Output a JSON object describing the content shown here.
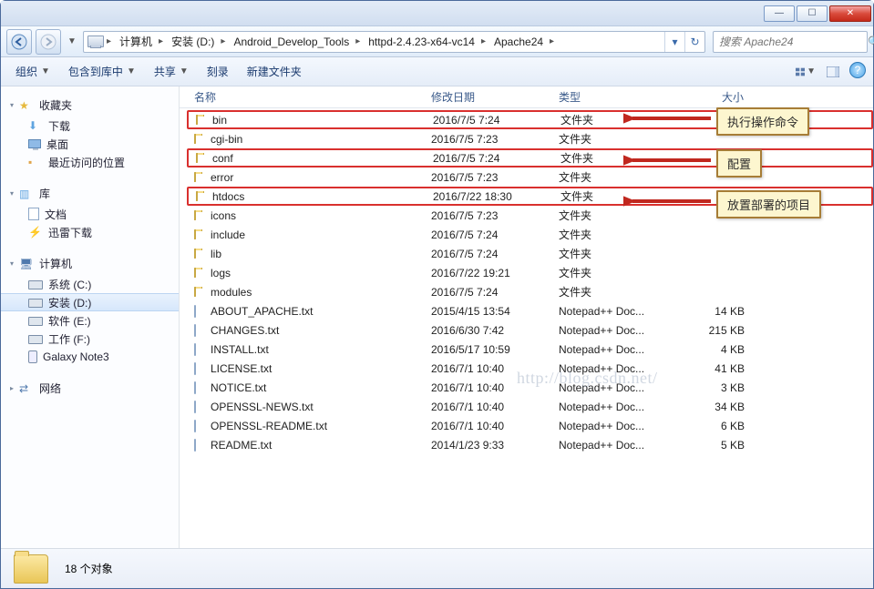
{
  "window": {
    "min_btn": "—",
    "max_btn": "☐",
    "close_btn": "✕"
  },
  "breadcrumb": {
    "items": [
      "计算机",
      "安装 (D:)",
      "Android_Develop_Tools",
      "httpd-2.4.23-x64-vc14",
      "Apache24"
    ]
  },
  "search": {
    "placeholder": "搜索 Apache24"
  },
  "toolbar": {
    "organize": "组织",
    "include": "包含到库中",
    "share": "共享",
    "burn": "刻录",
    "newfolder": "新建文件夹"
  },
  "columns": {
    "name": "名称",
    "date": "修改日期",
    "type": "类型",
    "size": "大小"
  },
  "sidebar": {
    "favorites": "收藏夹",
    "downloads": "下载",
    "desktop": "桌面",
    "recent": "最近访问的位置",
    "libraries": "库",
    "documents": "文档",
    "thunder": "迅雷下载",
    "computer": "计算机",
    "c_drive": "系统 (C:)",
    "d_drive": "安装 (D:)",
    "e_drive": "软件 (E:)",
    "f_drive": "工作 (F:)",
    "galaxy": "Galaxy Note3",
    "network": "网络"
  },
  "files": [
    {
      "name": "bin",
      "date": "2016/7/5 7:24",
      "type": "文件夹",
      "size": "",
      "kind": "folder",
      "hl": true
    },
    {
      "name": "cgi-bin",
      "date": "2016/7/5 7:23",
      "type": "文件夹",
      "size": "",
      "kind": "folder"
    },
    {
      "name": "conf",
      "date": "2016/7/5 7:24",
      "type": "文件夹",
      "size": "",
      "kind": "folder",
      "hl": true
    },
    {
      "name": "error",
      "date": "2016/7/5 7:23",
      "type": "文件夹",
      "size": "",
      "kind": "folder"
    },
    {
      "name": "htdocs",
      "date": "2016/7/22 18:30",
      "type": "文件夹",
      "size": "",
      "kind": "folder",
      "hl": true
    },
    {
      "name": "icons",
      "date": "2016/7/5 7:23",
      "type": "文件夹",
      "size": "",
      "kind": "folder"
    },
    {
      "name": "include",
      "date": "2016/7/5 7:24",
      "type": "文件夹",
      "size": "",
      "kind": "folder"
    },
    {
      "name": "lib",
      "date": "2016/7/5 7:24",
      "type": "文件夹",
      "size": "",
      "kind": "folder"
    },
    {
      "name": "logs",
      "date": "2016/7/22 19:21",
      "type": "文件夹",
      "size": "",
      "kind": "folder"
    },
    {
      "name": "modules",
      "date": "2016/7/5 7:24",
      "type": "文件夹",
      "size": "",
      "kind": "folder"
    },
    {
      "name": "ABOUT_APACHE.txt",
      "date": "2015/4/15 13:54",
      "type": "Notepad++ Doc...",
      "size": "14 KB",
      "kind": "file"
    },
    {
      "name": "CHANGES.txt",
      "date": "2016/6/30 7:42",
      "type": "Notepad++ Doc...",
      "size": "215 KB",
      "kind": "file"
    },
    {
      "name": "INSTALL.txt",
      "date": "2016/5/17 10:59",
      "type": "Notepad++ Doc...",
      "size": "4 KB",
      "kind": "file"
    },
    {
      "name": "LICENSE.txt",
      "date": "2016/7/1 10:40",
      "type": "Notepad++ Doc...",
      "size": "41 KB",
      "kind": "file"
    },
    {
      "name": "NOTICE.txt",
      "date": "2016/7/1 10:40",
      "type": "Notepad++ Doc...",
      "size": "3 KB",
      "kind": "file"
    },
    {
      "name": "OPENSSL-NEWS.txt",
      "date": "2016/7/1 10:40",
      "type": "Notepad++ Doc...",
      "size": "34 KB",
      "kind": "file"
    },
    {
      "name": "OPENSSL-README.txt",
      "date": "2016/7/1 10:40",
      "type": "Notepad++ Doc...",
      "size": "6 KB",
      "kind": "file"
    },
    {
      "name": "README.txt",
      "date": "2014/1/23 9:33",
      "type": "Notepad++ Doc...",
      "size": "5 KB",
      "kind": "file"
    }
  ],
  "status": {
    "count_text": "18 个对象"
  },
  "annotations": {
    "a1": "执行操作命令",
    "a2": "配置",
    "a3": "放置部署的项目"
  },
  "watermark": "http://blog.csdn.net/"
}
